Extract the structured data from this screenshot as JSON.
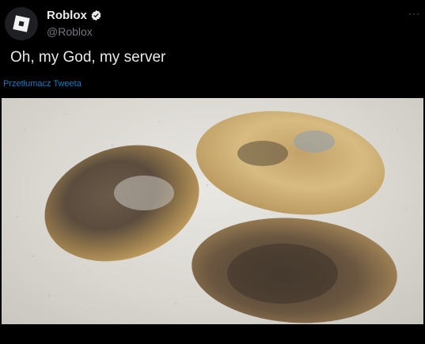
{
  "tweet": {
    "display_name": "Roblox",
    "handle": "@Roblox",
    "text": "Oh, my God, my server",
    "translate_label": "Przetłumacz Tweeta",
    "more_label": "···"
  },
  "icons": {
    "avatar": "roblox-logo-icon",
    "verified": "verified-badge-icon",
    "more": "more-options-icon"
  },
  "colors": {
    "background": "#000000",
    "text": "#e7e9ea",
    "secondary": "#71767b",
    "accent": "#1d9bf0"
  },
  "media": {
    "alt": "potatoes-photo"
  }
}
